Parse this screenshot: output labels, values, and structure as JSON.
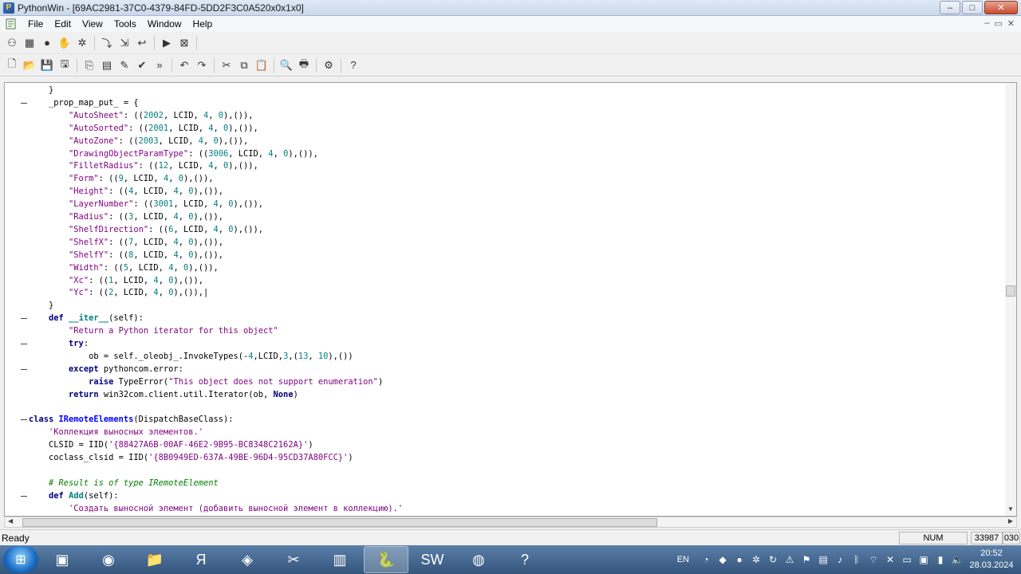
{
  "window": {
    "title": "PythonWin - [69AC2981-37C0-4379-84FD-5DD2F3C0A520x0x1x0]",
    "controls": {
      "minimize": "–",
      "maximize": "□",
      "close": "✕"
    }
  },
  "menu": {
    "items": [
      "File",
      "Edit",
      "View",
      "Tools",
      "Window",
      "Help"
    ],
    "mdi_controls": [
      "–",
      "▭",
      "✕"
    ]
  },
  "toolbar1": {
    "buttons": [
      {
        "icon": "watch-icon",
        "glyph": "⚇"
      },
      {
        "icon": "grid-icon",
        "glyph": "▦"
      },
      {
        "icon": "stop-icon",
        "glyph": "●"
      },
      {
        "icon": "hand-icon",
        "glyph": "✋"
      },
      {
        "icon": "gear-icon",
        "glyph": "✲"
      },
      {
        "icon": "step-into-icon",
        "glyph": "⤵"
      },
      {
        "icon": "step-over-icon",
        "glyph": "⇲"
      },
      {
        "icon": "step-out-icon",
        "glyph": "↩"
      },
      {
        "icon": "run-icon",
        "glyph": "▶"
      },
      {
        "icon": "close-debug-icon",
        "glyph": "⊠"
      }
    ]
  },
  "toolbar2": {
    "buttons": [
      {
        "icon": "new-file-icon",
        "glyph": "🗋"
      },
      {
        "icon": "open-folder-icon",
        "glyph": "📂"
      },
      {
        "icon": "save-icon",
        "glyph": "💾"
      },
      {
        "icon": "save-all-icon",
        "glyph": "🖫"
      },
      {
        "icon": "import-icon",
        "glyph": "⎘"
      },
      {
        "icon": "checkmodule-icon",
        "glyph": "▤"
      },
      {
        "icon": "brush-icon",
        "glyph": "✎"
      },
      {
        "icon": "check-icon",
        "glyph": "✔"
      },
      {
        "icon": "expand-icon",
        "glyph": "»"
      },
      {
        "icon": "undo-icon",
        "glyph": "↶"
      },
      {
        "icon": "redo-icon",
        "glyph": "↷"
      },
      {
        "icon": "cut-icon",
        "glyph": "✂"
      },
      {
        "icon": "copy-icon",
        "glyph": "⧉"
      },
      {
        "icon": "paste-icon",
        "glyph": "📋"
      },
      {
        "icon": "print-preview-icon",
        "glyph": "🔍"
      },
      {
        "icon": "print-icon",
        "glyph": "🖶"
      },
      {
        "icon": "python-icon",
        "glyph": "⚙"
      },
      {
        "icon": "help-icon",
        "glyph": "?"
      }
    ]
  },
  "code": {
    "lines": [
      [
        {
          "t": "\t}",
          "c": "plain"
        }
      ],
      [
        {
          "t": "\t_prop_map_put_ = {",
          "c": "plain"
        }
      ],
      [
        {
          "t": "\t\t",
          "c": "plain"
        },
        {
          "t": "\"AutoSheet\"",
          "c": "str"
        },
        {
          "t": ": ((",
          "c": "plain"
        },
        {
          "t": "2002",
          "c": "num"
        },
        {
          "t": ", LCID, ",
          "c": "plain"
        },
        {
          "t": "4",
          "c": "num"
        },
        {
          "t": ", ",
          "c": "plain"
        },
        {
          "t": "0",
          "c": "num"
        },
        {
          "t": "),()),",
          "c": "plain"
        }
      ],
      [
        {
          "t": "\t\t",
          "c": "plain"
        },
        {
          "t": "\"AutoSorted\"",
          "c": "str"
        },
        {
          "t": ": ((",
          "c": "plain"
        },
        {
          "t": "2001",
          "c": "num"
        },
        {
          "t": ", LCID, ",
          "c": "plain"
        },
        {
          "t": "4",
          "c": "num"
        },
        {
          "t": ", ",
          "c": "plain"
        },
        {
          "t": "0",
          "c": "num"
        },
        {
          "t": "),()),",
          "c": "plain"
        }
      ],
      [
        {
          "t": "\t\t",
          "c": "plain"
        },
        {
          "t": "\"AutoZone\"",
          "c": "str"
        },
        {
          "t": ": ((",
          "c": "plain"
        },
        {
          "t": "2003",
          "c": "num"
        },
        {
          "t": ", LCID, ",
          "c": "plain"
        },
        {
          "t": "4",
          "c": "num"
        },
        {
          "t": ", ",
          "c": "plain"
        },
        {
          "t": "0",
          "c": "num"
        },
        {
          "t": "),()),",
          "c": "plain"
        }
      ],
      [
        {
          "t": "\t\t",
          "c": "plain"
        },
        {
          "t": "\"DrawingObjectParamType\"",
          "c": "str"
        },
        {
          "t": ": ((",
          "c": "plain"
        },
        {
          "t": "3006",
          "c": "num"
        },
        {
          "t": ", LCID, ",
          "c": "plain"
        },
        {
          "t": "4",
          "c": "num"
        },
        {
          "t": ", ",
          "c": "plain"
        },
        {
          "t": "0",
          "c": "num"
        },
        {
          "t": "),()),",
          "c": "plain"
        }
      ],
      [
        {
          "t": "\t\t",
          "c": "plain"
        },
        {
          "t": "\"FilletRadius\"",
          "c": "str"
        },
        {
          "t": ": ((",
          "c": "plain"
        },
        {
          "t": "12",
          "c": "num"
        },
        {
          "t": ", LCID, ",
          "c": "plain"
        },
        {
          "t": "4",
          "c": "num"
        },
        {
          "t": ", ",
          "c": "plain"
        },
        {
          "t": "0",
          "c": "num"
        },
        {
          "t": "),()),",
          "c": "plain"
        }
      ],
      [
        {
          "t": "\t\t",
          "c": "plain"
        },
        {
          "t": "\"Form\"",
          "c": "str"
        },
        {
          "t": ": ((",
          "c": "plain"
        },
        {
          "t": "9",
          "c": "num"
        },
        {
          "t": ", LCID, ",
          "c": "plain"
        },
        {
          "t": "4",
          "c": "num"
        },
        {
          "t": ", ",
          "c": "plain"
        },
        {
          "t": "0",
          "c": "num"
        },
        {
          "t": "),()),",
          "c": "plain"
        }
      ],
      [
        {
          "t": "\t\t",
          "c": "plain"
        },
        {
          "t": "\"Height\"",
          "c": "str"
        },
        {
          "t": ": ((",
          "c": "plain"
        },
        {
          "t": "4",
          "c": "num"
        },
        {
          "t": ", LCID, ",
          "c": "plain"
        },
        {
          "t": "4",
          "c": "num"
        },
        {
          "t": ", ",
          "c": "plain"
        },
        {
          "t": "0",
          "c": "num"
        },
        {
          "t": "),()),",
          "c": "plain"
        }
      ],
      [
        {
          "t": "\t\t",
          "c": "plain"
        },
        {
          "t": "\"LayerNumber\"",
          "c": "str"
        },
        {
          "t": ": ((",
          "c": "plain"
        },
        {
          "t": "3001",
          "c": "num"
        },
        {
          "t": ", LCID, ",
          "c": "plain"
        },
        {
          "t": "4",
          "c": "num"
        },
        {
          "t": ", ",
          "c": "plain"
        },
        {
          "t": "0",
          "c": "num"
        },
        {
          "t": "),()),",
          "c": "plain"
        }
      ],
      [
        {
          "t": "\t\t",
          "c": "plain"
        },
        {
          "t": "\"Radius\"",
          "c": "str"
        },
        {
          "t": ": ((",
          "c": "plain"
        },
        {
          "t": "3",
          "c": "num"
        },
        {
          "t": ", LCID, ",
          "c": "plain"
        },
        {
          "t": "4",
          "c": "num"
        },
        {
          "t": ", ",
          "c": "plain"
        },
        {
          "t": "0",
          "c": "num"
        },
        {
          "t": "),()),",
          "c": "plain"
        }
      ],
      [
        {
          "t": "\t\t",
          "c": "plain"
        },
        {
          "t": "\"ShelfDirection\"",
          "c": "str"
        },
        {
          "t": ": ((",
          "c": "plain"
        },
        {
          "t": "6",
          "c": "num"
        },
        {
          "t": ", LCID, ",
          "c": "plain"
        },
        {
          "t": "4",
          "c": "num"
        },
        {
          "t": ", ",
          "c": "plain"
        },
        {
          "t": "0",
          "c": "num"
        },
        {
          "t": "),()),",
          "c": "plain"
        }
      ],
      [
        {
          "t": "\t\t",
          "c": "plain"
        },
        {
          "t": "\"ShelfX\"",
          "c": "str"
        },
        {
          "t": ": ((",
          "c": "plain"
        },
        {
          "t": "7",
          "c": "num"
        },
        {
          "t": ", LCID, ",
          "c": "plain"
        },
        {
          "t": "4",
          "c": "num"
        },
        {
          "t": ", ",
          "c": "plain"
        },
        {
          "t": "0",
          "c": "num"
        },
        {
          "t": "),()),",
          "c": "plain"
        }
      ],
      [
        {
          "t": "\t\t",
          "c": "plain"
        },
        {
          "t": "\"ShelfY\"",
          "c": "str"
        },
        {
          "t": ": ((",
          "c": "plain"
        },
        {
          "t": "8",
          "c": "num"
        },
        {
          "t": ", LCID, ",
          "c": "plain"
        },
        {
          "t": "4",
          "c": "num"
        },
        {
          "t": ", ",
          "c": "plain"
        },
        {
          "t": "0",
          "c": "num"
        },
        {
          "t": "),()),",
          "c": "plain"
        }
      ],
      [
        {
          "t": "\t\t",
          "c": "plain"
        },
        {
          "t": "\"Width\"",
          "c": "str"
        },
        {
          "t": ": ((",
          "c": "plain"
        },
        {
          "t": "5",
          "c": "num"
        },
        {
          "t": ", LCID, ",
          "c": "plain"
        },
        {
          "t": "4",
          "c": "num"
        },
        {
          "t": ", ",
          "c": "plain"
        },
        {
          "t": "0",
          "c": "num"
        },
        {
          "t": "),()),",
          "c": "plain"
        }
      ],
      [
        {
          "t": "\t\t",
          "c": "plain"
        },
        {
          "t": "\"Xc\"",
          "c": "str"
        },
        {
          "t": ": ((",
          "c": "plain"
        },
        {
          "t": "1",
          "c": "num"
        },
        {
          "t": ", LCID, ",
          "c": "plain"
        },
        {
          "t": "4",
          "c": "num"
        },
        {
          "t": ", ",
          "c": "plain"
        },
        {
          "t": "0",
          "c": "num"
        },
        {
          "t": "),()),",
          "c": "plain"
        }
      ],
      [
        {
          "t": "\t\t",
          "c": "plain"
        },
        {
          "t": "\"Yc\"",
          "c": "str"
        },
        {
          "t": ": ((",
          "c": "plain"
        },
        {
          "t": "2",
          "c": "num"
        },
        {
          "t": ", LCID, ",
          "c": "plain"
        },
        {
          "t": "4",
          "c": "num"
        },
        {
          "t": ", ",
          "c": "plain"
        },
        {
          "t": "0",
          "c": "num"
        },
        {
          "t": "),()),|",
          "c": "plain"
        }
      ],
      [
        {
          "t": "\t}",
          "c": "plain"
        }
      ],
      [
        {
          "t": "\t",
          "c": "plain"
        },
        {
          "t": "def",
          "c": "kw"
        },
        {
          "t": " ",
          "c": "plain"
        },
        {
          "t": "__iter__",
          "c": "def-name"
        },
        {
          "t": "(self):",
          "c": "plain"
        }
      ],
      [
        {
          "t": "\t\t",
          "c": "plain"
        },
        {
          "t": "\"Return a Python iterator for this object\"",
          "c": "str"
        }
      ],
      [
        {
          "t": "\t\t",
          "c": "plain"
        },
        {
          "t": "try",
          "c": "kw"
        },
        {
          "t": ":",
          "c": "plain"
        }
      ],
      [
        {
          "t": "\t\t\tob = self._oleobj_.InvokeTypes(-",
          "c": "plain"
        },
        {
          "t": "4",
          "c": "num"
        },
        {
          "t": ",LCID,",
          "c": "plain"
        },
        {
          "t": "3",
          "c": "num"
        },
        {
          "t": ",(",
          "c": "plain"
        },
        {
          "t": "13",
          "c": "num"
        },
        {
          "t": ", ",
          "c": "plain"
        },
        {
          "t": "10",
          "c": "num"
        },
        {
          "t": "),())",
          "c": "plain"
        }
      ],
      [
        {
          "t": "\t\t",
          "c": "plain"
        },
        {
          "t": "except",
          "c": "kw"
        },
        {
          "t": " pythoncom.error:",
          "c": "plain"
        }
      ],
      [
        {
          "t": "\t\t\t",
          "c": "plain"
        },
        {
          "t": "raise",
          "c": "kw"
        },
        {
          "t": " TypeError(",
          "c": "plain"
        },
        {
          "t": "\"This object does not support enumeration\"",
          "c": "str"
        },
        {
          "t": ")",
          "c": "plain"
        }
      ],
      [
        {
          "t": "\t\t",
          "c": "plain"
        },
        {
          "t": "return",
          "c": "kw"
        },
        {
          "t": " win32com.client.util.Iterator(ob, ",
          "c": "plain"
        },
        {
          "t": "None",
          "c": "kw"
        },
        {
          "t": ")",
          "c": "plain"
        }
      ],
      [
        {
          "t": "",
          "c": "plain"
        }
      ],
      [
        {
          "t": "class",
          "c": "kw"
        },
        {
          "t": " ",
          "c": "plain"
        },
        {
          "t": "IRemoteElements",
          "c": "cls"
        },
        {
          "t": "(DispatchBaseClass):",
          "c": "plain"
        }
      ],
      [
        {
          "t": "\t",
          "c": "plain"
        },
        {
          "t": "'Коллекция выносных элементов.'",
          "c": "str"
        }
      ],
      [
        {
          "t": "\tCLSID = IID(",
          "c": "plain"
        },
        {
          "t": "'{88427A6B-00AF-46E2-9B95-BC8348C2162A}'",
          "c": "str"
        },
        {
          "t": ")",
          "c": "plain"
        }
      ],
      [
        {
          "t": "\tcoclass_clsid = IID(",
          "c": "plain"
        },
        {
          "t": "'{8B0949ED-637A-49BE-96D4-95CD37A80FCC}'",
          "c": "str"
        },
        {
          "t": ")",
          "c": "plain"
        }
      ],
      [
        {
          "t": "",
          "c": "plain"
        }
      ],
      [
        {
          "t": "\t",
          "c": "plain"
        },
        {
          "t": "# Result is of type IRemoteElement",
          "c": "cmt"
        }
      ],
      [
        {
          "t": "\t",
          "c": "plain"
        },
        {
          "t": "def",
          "c": "kw"
        },
        {
          "t": " ",
          "c": "plain"
        },
        {
          "t": "Add",
          "c": "def-name"
        },
        {
          "t": "(self):",
          "c": "plain"
        }
      ],
      [
        {
          "t": "\t\t",
          "c": "plain"
        },
        {
          "t": "'Создать выносной элемент (добавить выносной элемент в коллекцию).'",
          "c": "str"
        }
      ]
    ],
    "fold_markers": [
      1,
      18,
      20,
      22,
      26,
      32
    ]
  },
  "status": {
    "text": "Ready",
    "num": "NUM",
    "position": "33987",
    "column": "030"
  },
  "taskbar": {
    "apps": [
      {
        "name": "explorer-windows",
        "glyph": "▣"
      },
      {
        "name": "firefox",
        "glyph": "◉"
      },
      {
        "name": "file-explorer",
        "glyph": "📁"
      },
      {
        "name": "yandex",
        "glyph": "Я"
      },
      {
        "name": "kompas",
        "glyph": "◈"
      },
      {
        "name": "tool",
        "glyph": "✂"
      },
      {
        "name": "calculator",
        "glyph": "▥"
      },
      {
        "name": "pythonwin",
        "glyph": "🐍"
      },
      {
        "name": "solidworks",
        "glyph": "SW"
      },
      {
        "name": "obs",
        "glyph": "◍"
      },
      {
        "name": "help",
        "glyph": "?"
      }
    ],
    "language": "EN",
    "time": "20:52",
    "date": "28.03.2024"
  }
}
